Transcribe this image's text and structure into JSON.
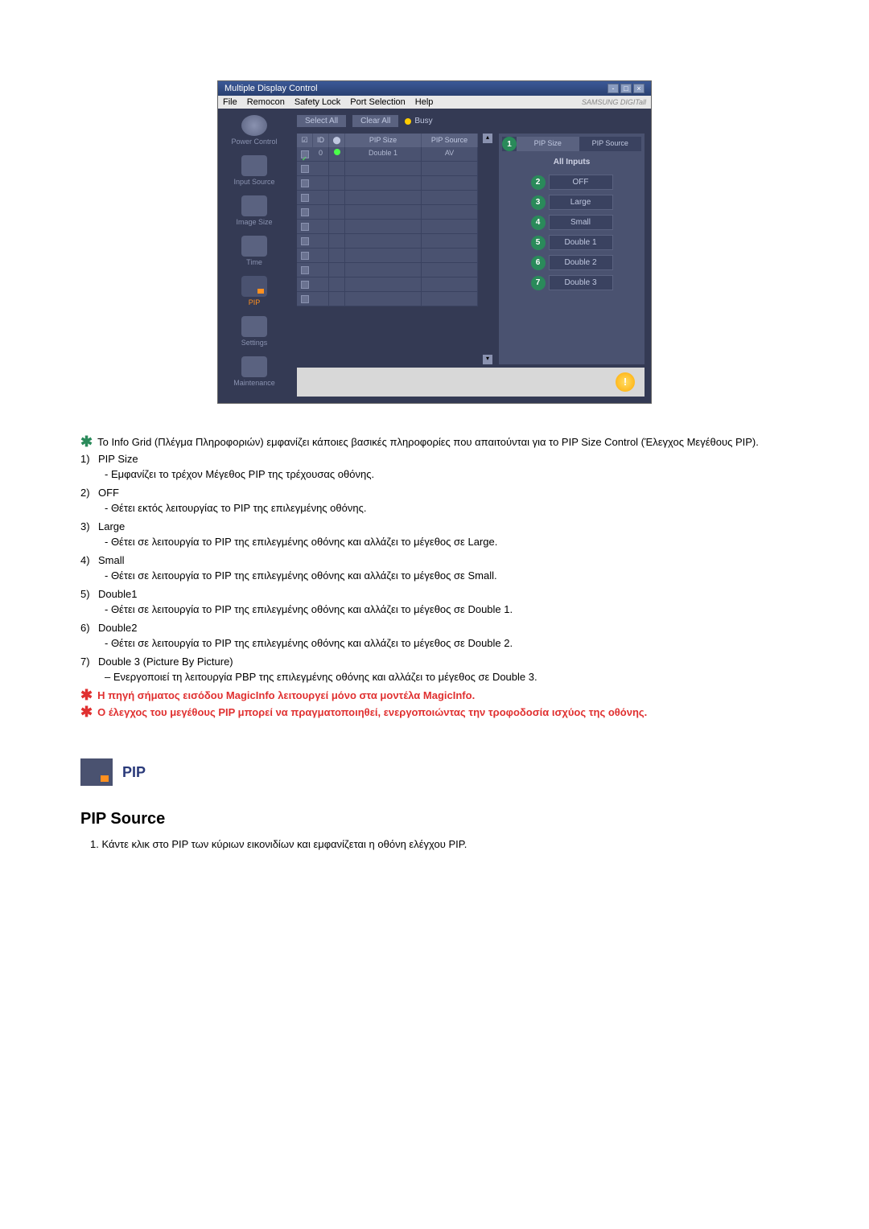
{
  "window": {
    "title": "Multiple Display Control"
  },
  "menubar": {
    "file": "File",
    "remocon": "Remocon",
    "safety_lock": "Safety Lock",
    "port_selection": "Port Selection",
    "help": "Help",
    "brand": "SAMSUNG DIGITall"
  },
  "sidebar": {
    "items": [
      {
        "label": "Power Control"
      },
      {
        "label": "Input Source"
      },
      {
        "label": "Image Size"
      },
      {
        "label": "Time"
      },
      {
        "label": "PIP"
      },
      {
        "label": "Settings"
      },
      {
        "label": "Maintenance"
      }
    ]
  },
  "toolbar": {
    "select_all": "Select All",
    "clear_all": "Clear All",
    "busy": "Busy"
  },
  "grid": {
    "headers": {
      "id": "ID",
      "pip_size": "PIP Size",
      "pip_source": "PIP Source"
    },
    "rows": [
      {
        "id": "0",
        "checked": true,
        "status": "on",
        "pip_size": "Double 1",
        "pip_source": "AV"
      }
    ],
    "empty_row_count": 10
  },
  "panel": {
    "header_size": "PIP Size",
    "header_source": "PIP Source",
    "all_inputs": "All Inputs",
    "callout_1": "1",
    "options": [
      {
        "num": "2",
        "label": "OFF"
      },
      {
        "num": "3",
        "label": "Large"
      },
      {
        "num": "4",
        "label": "Small"
      },
      {
        "num": "5",
        "label": "Double 1"
      },
      {
        "num": "6",
        "label": "Double 2"
      },
      {
        "num": "7",
        "label": "Double 3"
      }
    ]
  },
  "doc": {
    "intro_note": "Το Info Grid (Πλέγμα Πληροφοριών) εμφανίζει κάποιες βασικές πληροφορίες που απαιτούνται για το PIP Size Control (Έλεγχος Μεγέθους PIP).",
    "items": [
      {
        "num": "1)",
        "title": "PIP Size",
        "desc": "- Εμφανίζει το τρέχον Μέγεθος PIP της τρέχουσας οθόνης."
      },
      {
        "num": "2)",
        "title": "OFF",
        "desc": "- Θέτει εκτός λειτουργίας το PIP της επιλεγμένης οθόνης."
      },
      {
        "num": "3)",
        "title": "Large",
        "desc": "- Θέτει σε λειτουργία το PIP της επιλεγμένης οθόνης και αλλάζει το μέγεθος σε Large."
      },
      {
        "num": "4)",
        "title": "Small",
        "desc": "- Θέτει σε λειτουργία το PIP της επιλεγμένης οθόνης και αλλάζει το μέγεθος σε Small."
      },
      {
        "num": "5)",
        "title": "Double1",
        "desc": "- Θέτει σε λειτουργία το PIP της επιλεγμένης οθόνης και αλλάζει το μέγεθος σε Double 1."
      },
      {
        "num": "6)",
        "title": "Double2",
        "desc": "- Θέτει σε λειτουργία το PIP της επιλεγμένης οθόνης και αλλάζει το μέγεθος σε Double 2."
      },
      {
        "num": "7)",
        "title": "Double 3 (Picture By Picture)",
        "desc": "– Ενεργοποιεί τη λειτουργία PBP της επιλεγμένης οθόνης και αλλάζει το μέγεθος σε Double 3."
      }
    ],
    "warn1": "Η πηγή σήματος εισόδου MagicInfo λειτουργεί μόνο στα μοντέλα MagicInfo.",
    "warn2": "Ο έλεγχος του μεγέθους PIP μπορεί να πραγματοποιηθεί, ενεργοποιώντας την τροφοδοσία ισχύος της οθόνης.",
    "section_title": "PIP",
    "subsection_title": "PIP Source",
    "step1_num": "1.",
    "step1": "Κάντε κλικ στο PIP των κύριων εικονιδίων και εμφανίζεται η οθόνη ελέγχου PIP."
  }
}
